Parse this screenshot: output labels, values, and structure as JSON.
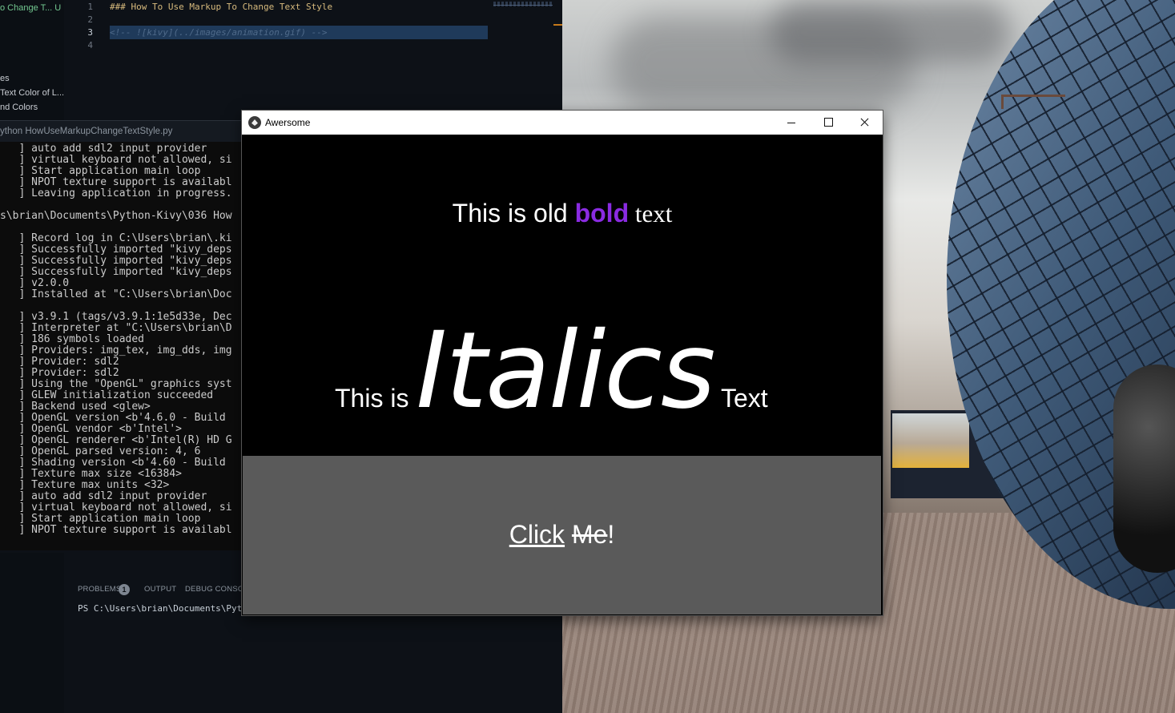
{
  "editor": {
    "explorer": [
      {
        "label": "o Change T...  U",
        "active": true
      },
      {
        "label": "es",
        "active": false
      },
      {
        "label": "Text Color of L...",
        "active": false
      },
      {
        "label": "nd Colors",
        "active": false
      }
    ],
    "lines": [
      {
        "num": "1",
        "text": "### How To Use Markup To Change Text Style",
        "kind": "h"
      },
      {
        "num": "2",
        "text": "",
        "kind": "h"
      },
      {
        "num": "3",
        "text": "<!-- ![kivy](../images/animation.gif) -->",
        "kind": "c"
      },
      {
        "num": "4",
        "text": "",
        "kind": "h"
      }
    ],
    "terminal_tab": "ython  HowUseMarkupChangeTextStyle.py",
    "terminal_lines": [
      "   ] auto add sdl2 input provider",
      "   ] virtual keyboard not allowed, si",
      "   ] Start application main loop",
      "   ] NPOT texture support is availabl",
      "   ] Leaving application in progress.",
      "",
      "s\\brian\\Documents\\Python-Kivy\\036 How",
      "",
      "   ] Record log in C:\\Users\\brian\\.ki",
      "   ] Successfully imported \"kivy_deps",
      "   ] Successfully imported \"kivy_deps",
      "   ] Successfully imported \"kivy_deps",
      "   ] v2.0.0",
      "   ] Installed at \"C:\\Users\\brian\\Doc",
      "",
      "   ] v3.9.1 (tags/v3.9.1:1e5d33e, Dec",
      "   ] Interpreter at \"C:\\Users\\brian\\D",
      "   ] 186 symbols loaded",
      "   ] Providers: img_tex, img_dds, img",
      "   ] Provider: sdl2",
      "   ] Provider: sdl2",
      "   ] Using the \"OpenGL\" graphics syst",
      "   ] GLEW initialization succeeded",
      "   ] Backend used <glew>",
      "   ] OpenGL version <b'4.6.0 - Build",
      "   ] OpenGL vendor <b'Intel'>",
      "   ] OpenGL renderer <b'Intel(R) HD G",
      "   ] OpenGL parsed version: 4, 6",
      "   ] Shading version <b'4.60 - Build",
      "   ] Texture max size <16384>",
      "   ] Texture max units <32>",
      "   ] auto add sdl2 input provider",
      "   ] virtual keyboard not allowed, si",
      "   ] Start application main loop",
      "   ] NPOT texture support is availabl"
    ],
    "panel_tabs": {
      "problems": "PROBLEMS",
      "problems_count": "1",
      "output": "OUTPUT",
      "debug": "DEBUG CONSOLE"
    },
    "ps_line": "PS C:\\Users\\brian\\Documents\\Python"
  },
  "window": {
    "title": "Awersome",
    "controls": {
      "minimize": "minimize",
      "maximize": "maximize",
      "close": "close"
    },
    "line1": {
      "pre": "This is old ",
      "bold": "bold",
      "post": " text"
    },
    "line2": {
      "pre": "This is ",
      "big": "Italics",
      "post": " Text"
    },
    "button": {
      "part1": "Click",
      "space": " ",
      "part2": "Me",
      "part3": "!"
    },
    "colors": {
      "bold": "#8a2be2",
      "button_bg": "#5a5a5a",
      "window_bg": "#000000"
    }
  }
}
